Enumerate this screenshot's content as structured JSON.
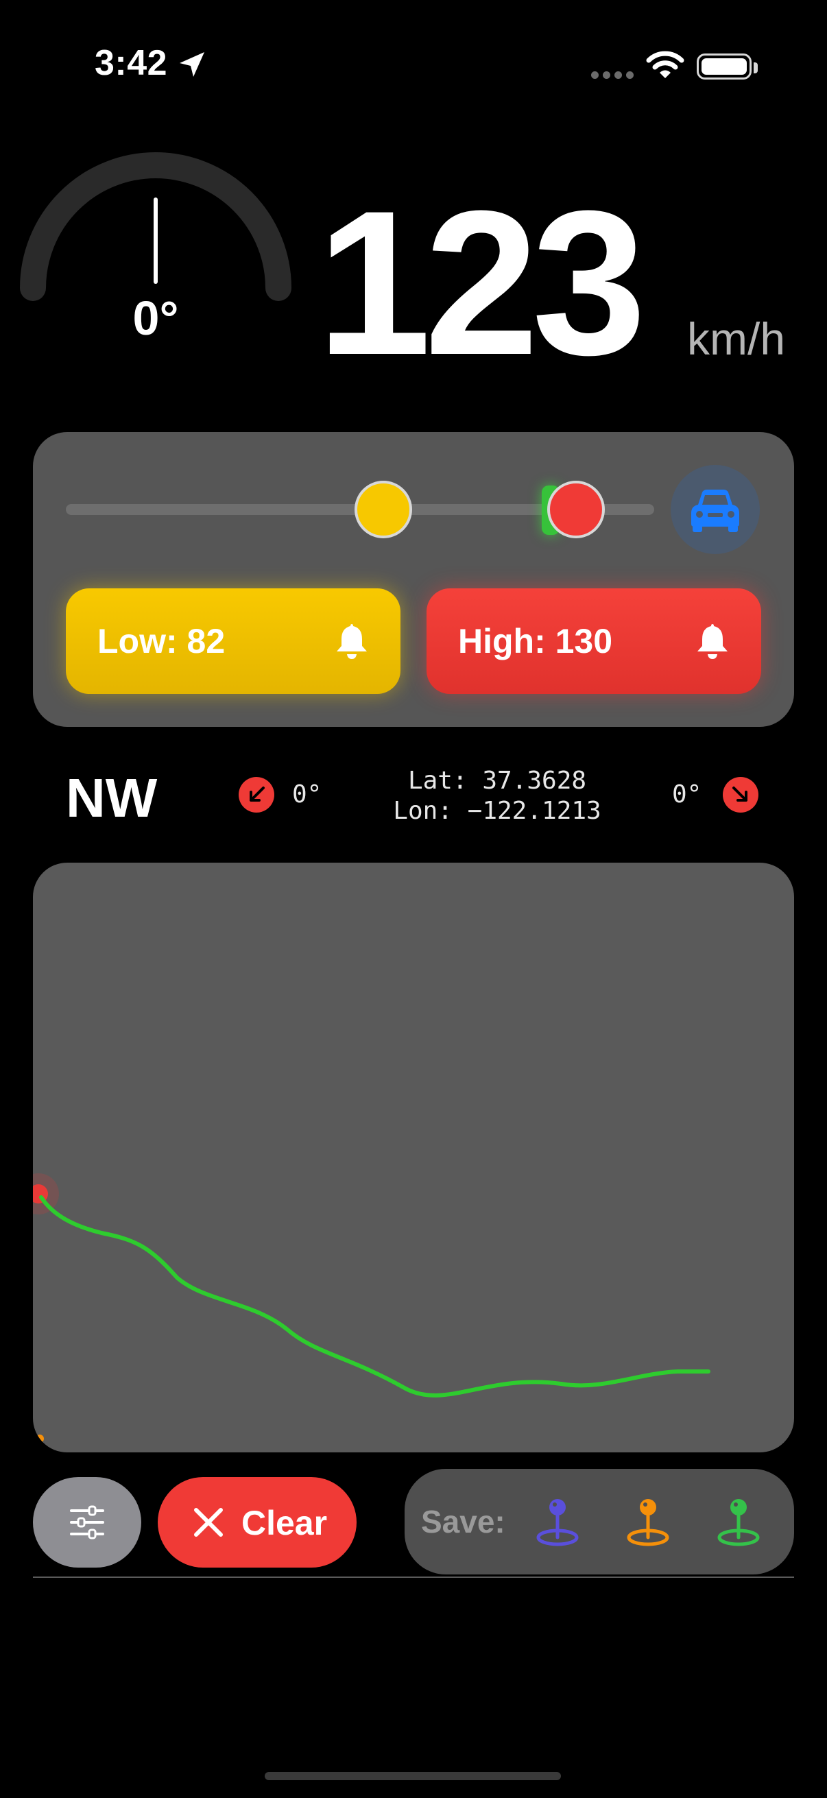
{
  "status_bar": {
    "time": "3:42",
    "location_icon": "location-arrow-icon",
    "wifi_icon": "wifi-icon",
    "battery_icon": "battery-icon"
  },
  "heading": {
    "value": "0°",
    "needle_angle_deg": 0
  },
  "speed": {
    "value": "123",
    "unit": "km/h"
  },
  "alerts": {
    "slider": {
      "low_thumb_value": 82,
      "high_thumb_value": 130
    },
    "car_button_icon": "car-icon",
    "low_label": "Low: 82",
    "high_label": "High: 130",
    "bell_icon": "bell-icon",
    "colors": {
      "low": "#f8c900",
      "high": "#f03a36",
      "car": "#1a7cff"
    }
  },
  "compass": {
    "direction": "NW",
    "tilt_left": "0°",
    "tilt_right": "0°",
    "lat": "Lat: 37.3628",
    "lon": "Lon: −122.1213"
  },
  "map": {
    "track_color": "#2ecc2e",
    "start_marker_color": "#f03a36"
  },
  "toolbar": {
    "settings_icon": "sliders-icon",
    "clear_label": "Clear",
    "save_label": "Save:",
    "pins": [
      {
        "name": "pin-blue-icon",
        "color": "#5a4fdc"
      },
      {
        "name": "pin-orange-icon",
        "color": "#f5900a"
      },
      {
        "name": "pin-green-icon",
        "color": "#34c24a"
      }
    ]
  }
}
